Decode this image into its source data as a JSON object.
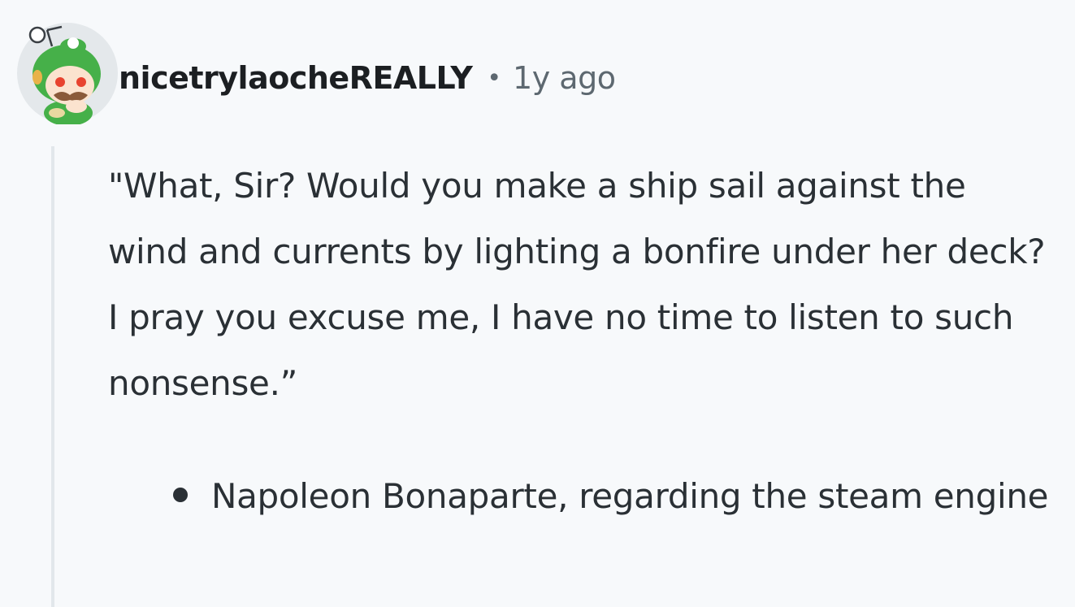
{
  "comment": {
    "author": "nicetrylaocheREALLY",
    "separator": "•",
    "timestamp": "1y ago",
    "body": "\"What, Sir? Would you make a ship sail against the wind and currents by lighting a bonfire under her deck? I pray you excuse me, I have no time to listen to such nonsense.”",
    "bullets": [
      "Napoleon Bonaparte, regarding the steam engine"
    ]
  },
  "avatar": {
    "icon": "snoo-avatar-icon",
    "background": "#e4e8eb",
    "hood_color": "#46b049",
    "face_color": "#fbe3cf",
    "eye_color": "#e8432f",
    "mustache_color": "#8a5a3a"
  },
  "colors": {
    "page_background": "#f7f9fb",
    "text": "#2a3035",
    "muted": "#5d6870",
    "thread_line": "#e2e7eb"
  }
}
